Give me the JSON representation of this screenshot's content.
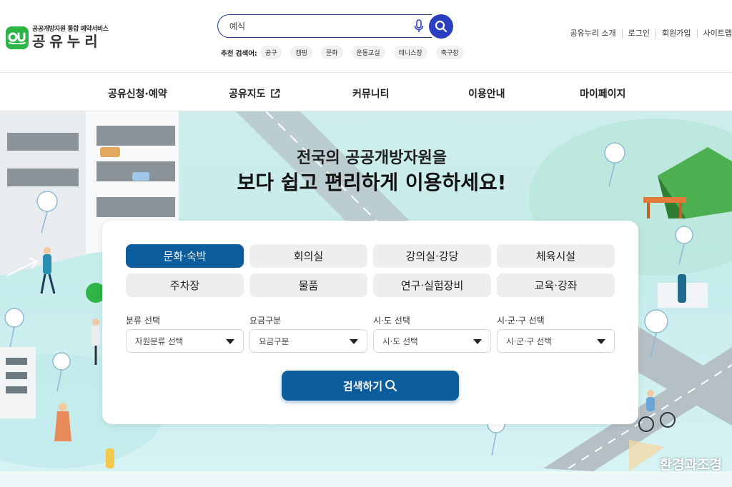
{
  "logo": {
    "subtitle": "공공개방자원 통합 예약서비스",
    "name": "공유누리"
  },
  "search": {
    "value": "",
    "placeholder": "예식",
    "recommend_label": "추천 검색어:",
    "recommend": [
      "공구",
      "캠핑",
      "문화",
      "운동교실",
      "테니스장",
      "축구장"
    ]
  },
  "util_menu": [
    "공유누리 소개",
    "로그인",
    "회원가입",
    "사이트맵"
  ],
  "nav": {
    "items": [
      "공유신청·예약",
      "공유지도",
      "커뮤니티",
      "이용안내",
      "마이페이지"
    ]
  },
  "hero": {
    "title_line1": "전국의 공공개방자원을",
    "title_line2": "보다 쉽고 편리하게 이용하세요!"
  },
  "categories": {
    "items": [
      "문화·숙박",
      "회의실",
      "강의실·강당",
      "체육시설",
      "주차장",
      "물품",
      "연구·실험장비",
      "교육·강좌"
    ],
    "active_index": 0
  },
  "filters": [
    {
      "label": "분류 선택",
      "selected": "자원분류 선택"
    },
    {
      "label": "요금구분",
      "selected": "요금구분"
    },
    {
      "label": "시·도 선택",
      "selected": "시·도 선택"
    },
    {
      "label": "시·군·구 선택",
      "selected": "시·군·구 선택"
    }
  ],
  "search_button": "검색하기",
  "watermark": "환경과조경",
  "colors": {
    "brand_green": "#2db548",
    "primary_blue": "#0c5d9e",
    "search_blue": "#2a3fbf",
    "hero_bg": "#cdeeea"
  }
}
